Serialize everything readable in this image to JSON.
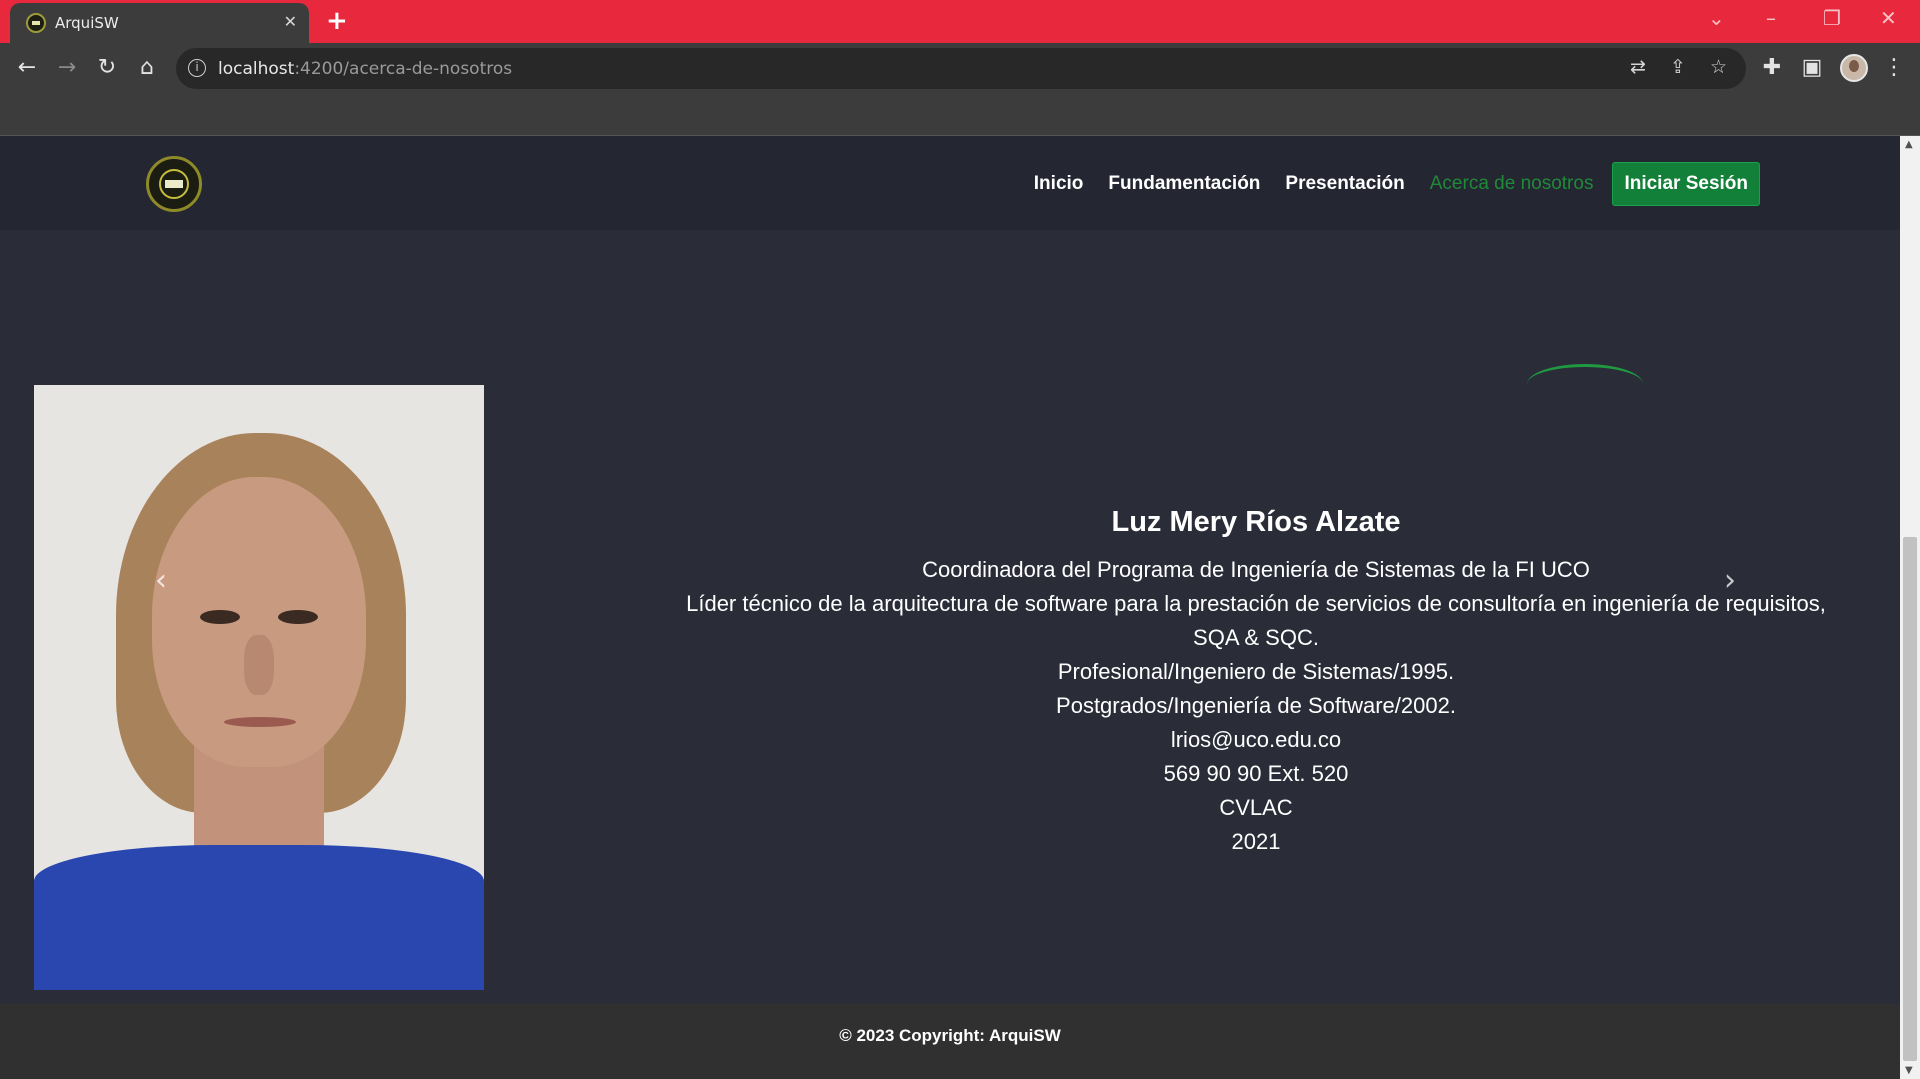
{
  "browser": {
    "tab_title": "ArquiSW",
    "tab_close": "✕",
    "new_tab": "+",
    "url_host": "localhost",
    "url_path": ":4200/acerca-de-nosotros"
  },
  "nav": {
    "links": [
      "Inicio",
      "Fundamentación",
      "Presentación",
      "Acerca de nosotros"
    ],
    "active_link": "Acerca de nosotros",
    "login_label": "Iniciar Sesión"
  },
  "profile": {
    "name": "Luz Mery Ríos Alzate",
    "lines": [
      "Coordinadora del Programa de Ingeniería de Sistemas de la FI UCO",
      "Líder técnico de la arquitectura de software para la prestación de servicios de consultoría en ingeniería de requisitos,",
      "SQA & SQC.",
      "Profesional/Ingeniero de Sistemas/1995.",
      "Postgrados/Ingeniería de Software/2002.",
      "lrios@uco.edu.co",
      "569 90 90 Ext. 520",
      "CVLAC",
      "2021"
    ]
  },
  "carousel": {
    "prev_icon": "‹",
    "next_icon": "›"
  },
  "footer": {
    "copyright": "© 2023 Copyright: ArquiSW"
  },
  "colors": {
    "tabstrip": "#e8283c",
    "accent_green": "#13803a",
    "page_bg": "#2a2d38"
  }
}
